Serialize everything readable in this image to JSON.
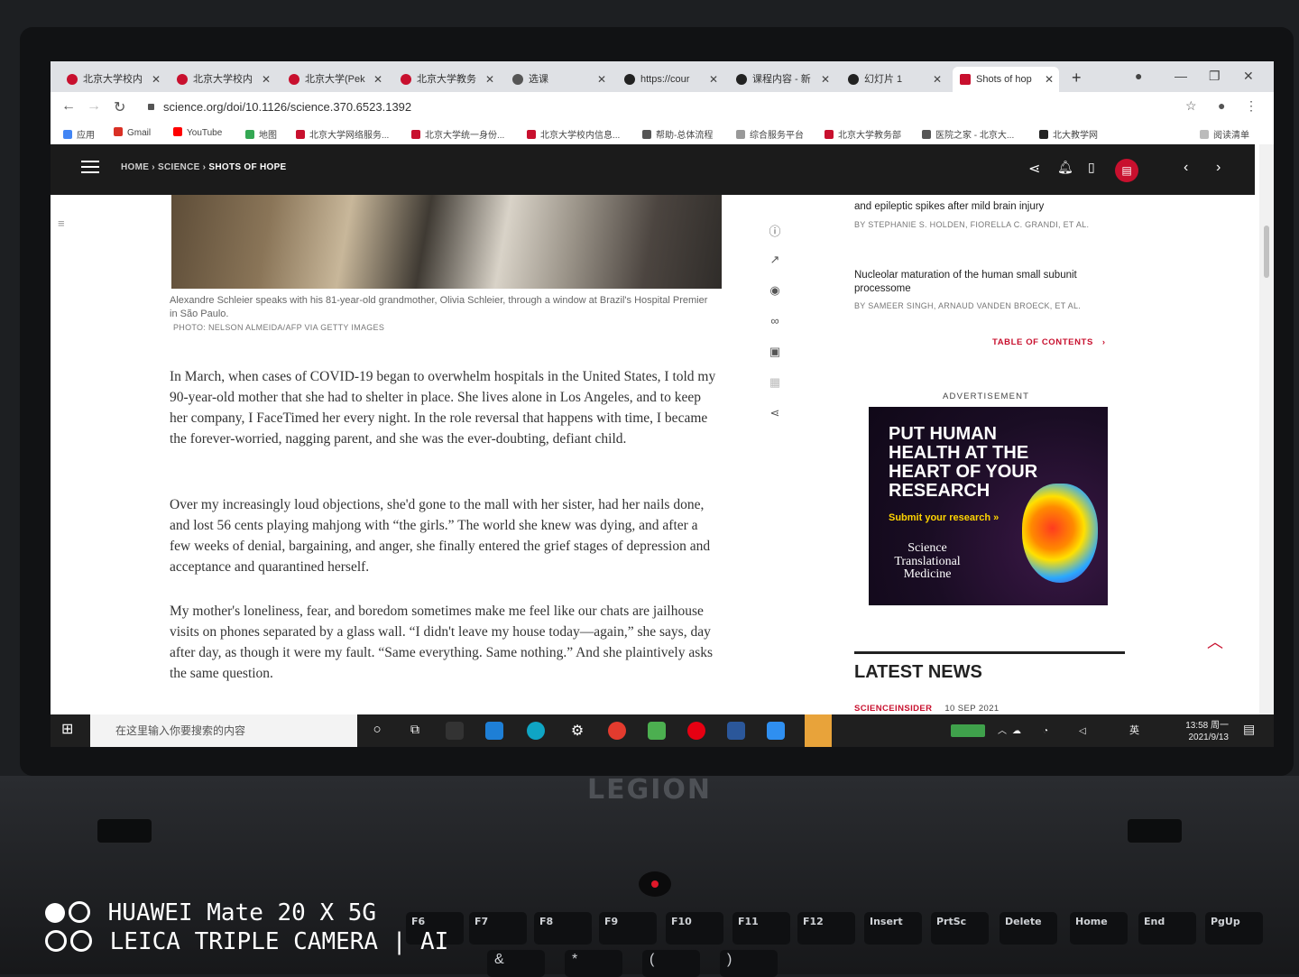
{
  "browser": {
    "tabs": [
      {
        "label": "北京大学校内",
        "color": "#c8102e"
      },
      {
        "label": "北京大学校内",
        "color": "#c8102e"
      },
      {
        "label": "北京大学(Pek",
        "color": "#c8102e"
      },
      {
        "label": "北京大学教务",
        "color": "#c8102e"
      },
      {
        "label": "选课",
        "color": "#555555"
      },
      {
        "label": "https://cour",
        "color": "#222222"
      },
      {
        "label": "课程内容 - 新",
        "color": "#222222"
      },
      {
        "label": "幻灯片 1",
        "color": "#222222"
      },
      {
        "label": "Shots of hop",
        "color": "#c8102e"
      }
    ],
    "new_tab": "+",
    "url": "science.org/doi/10.1126/science.370.6523.1392",
    "bookmarks": [
      "应用",
      "Gmail",
      "YouTube",
      "地图",
      "北京大学网络服务...",
      "北京大学统一身份...",
      "北京大学校内信息...",
      "帮助-总体流程",
      "综合服务平台",
      "北京大学教务部",
      "医院之家 - 北京大...",
      "北大教学网",
      "阅读清单"
    ]
  },
  "site": {
    "breadcrumb": {
      "home": "HOME",
      "section": "SCIENCE",
      "current": "SHOTS OF HOPE"
    }
  },
  "article": {
    "caption": "Alexandre Schleier speaks with his 81-year-old grandmother, Olivia Schleier, through a window at Brazil's Hospital Premier in São Paulo.",
    "credit": "PHOTO: NELSON ALMEIDA/AFP VIA GETTY IMAGES",
    "paragraphs": [
      "In March, when cases of COVID-19 began to overwhelm hospitals in the United States, I told my 90-year-old mother that she had to shelter in place. She lives alone in Los Angeles, and to keep her company, I FaceTimed her every night. In the role reversal that happens with time, I became the forever-worried, nagging parent, and she was the ever-doubting, defiant child.",
      "Over my increasingly loud objections, she'd gone to the mall with her sister, had her nails done, and lost 56 cents playing mahjong with “the girls.” The world she knew was dying, and after a few weeks of denial, bargaining, and anger, she finally entered the grief stages of depression and acceptance and quarantined herself.",
      "My mother's loneliness, fear, and boredom sometimes make me feel like our chats are jailhouse visits on phones separated by a glass wall. “I didn't leave my house today—again,” she says, day after day, as though it were my fault. “Same everything. Same nothing.” And she plaintively asks the same question."
    ]
  },
  "sidebar": {
    "related": [
      {
        "title": "and epileptic spikes after mild brain injury",
        "authors": "BY STEPHANIE S. HOLDEN, FIORELLA C. GRANDI, ET AL."
      },
      {
        "title": "Nucleolar maturation of the human small subunit processome",
        "authors": "BY SAMEER SINGH, ARNAUD VANDEN BROECK, ET AL."
      }
    ],
    "toc_label": "TABLE OF CONTENTS",
    "ad_label": "ADVERTISEMENT",
    "ad": {
      "headline": "PUT HUMAN HEALTH AT THE HEART OF YOUR RESEARCH",
      "cta": "Submit your research »",
      "brand": "Science Translational Medicine"
    },
    "latest_news": "LATEST NEWS",
    "news_meta": {
      "tag": "SCIENCEINSIDER",
      "date": "10 SEP 2021"
    }
  },
  "taskbar": {
    "search_placeholder": "在这里输入你要搜索的内容",
    "time": "13:58 周一",
    "date": "2021/9/13",
    "ime": "英"
  },
  "hardware": {
    "brand": "LEGION",
    "watermark_line1": "HUAWEI Mate 20 X 5G",
    "watermark_line2": "LEICA TRIPLE CAMERA | AI",
    "keys": [
      "F6",
      "F7",
      "F8",
      "F9",
      "F10",
      "F11",
      "F12",
      "Insert",
      "PrtSc",
      "Delete",
      "Home",
      "End",
      "PgUp"
    ]
  }
}
